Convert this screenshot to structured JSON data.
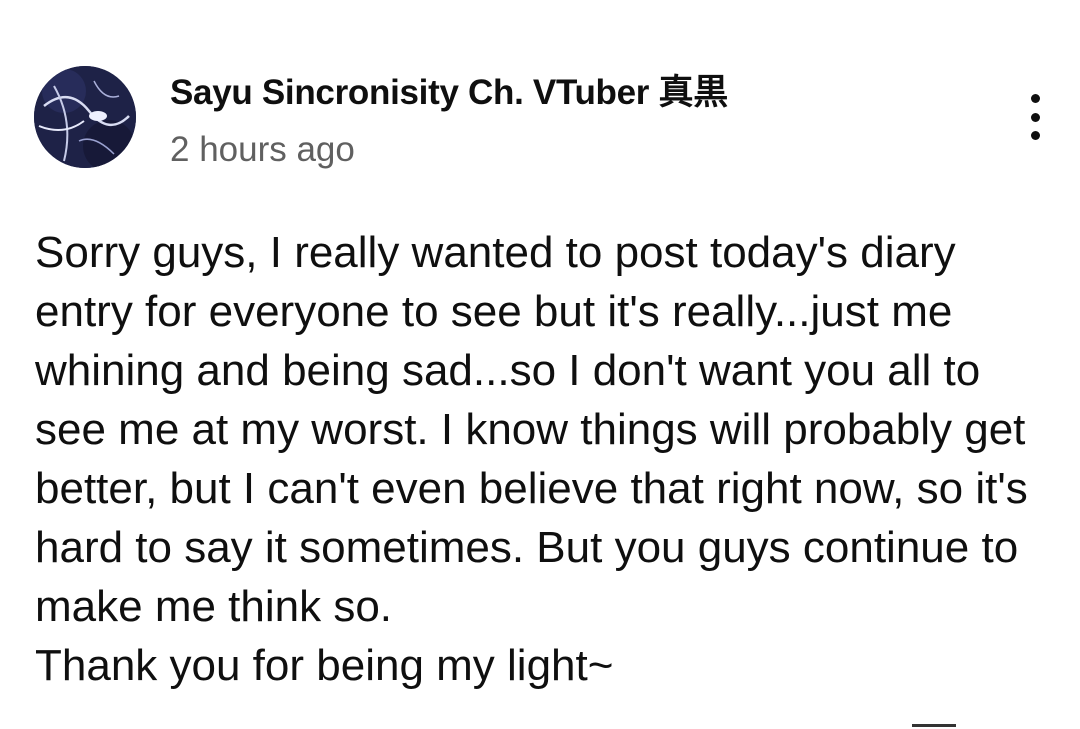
{
  "post": {
    "author": "Sayu Sincronisity Ch. VTuber 真黒",
    "timestamp": "2 hours ago",
    "paragraphs": [
      "Sorry guys, I really wanted to post today's diary entry for everyone to see but it's really...just me whining and being sad...so I don't want you all to see me at my worst. I know things will probably get better, but I can't even believe that right now, so it's hard to say it sometimes. But you guys continue to make me think so.",
      "Thank you for being my light~"
    ],
    "menu_icon": "vertical-ellipsis-icon"
  },
  "colors": {
    "text_primary": "#0f0f0f",
    "text_secondary": "#606060",
    "background": "#ffffff",
    "avatar_bg": "#1e2247"
  }
}
